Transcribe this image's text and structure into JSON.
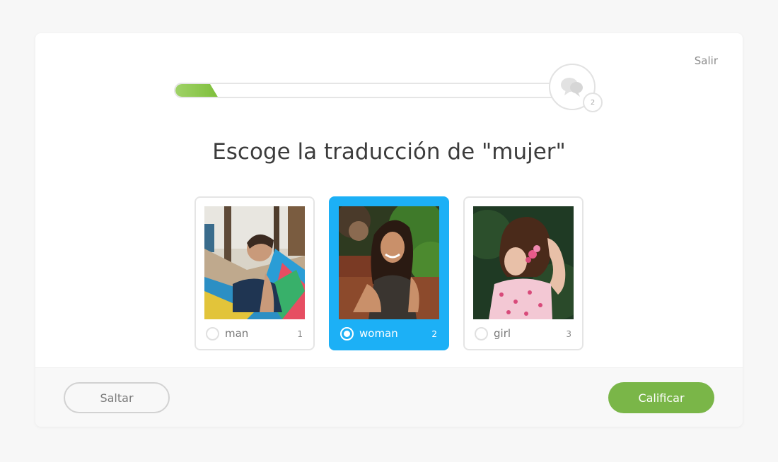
{
  "header": {
    "exit_label": "Salir",
    "progress": 0.11,
    "streak_count": "2"
  },
  "prompt": "Escoge la traducción de \"mujer\"",
  "choices": [
    {
      "label": "man",
      "hotkey": "1",
      "selected": false
    },
    {
      "label": "woman",
      "hotkey": "2",
      "selected": true
    },
    {
      "label": "girl",
      "hotkey": "3",
      "selected": false
    }
  ],
  "footer": {
    "skip_label": "Saltar",
    "check_label": "Calificar"
  },
  "colors": {
    "selected": "#1cb0f6",
    "progress": "#7fbf3c",
    "check_button": "#7ab648"
  },
  "icons": {
    "streak": "speech-bubbles-icon",
    "radio": "radio-button-icon"
  }
}
